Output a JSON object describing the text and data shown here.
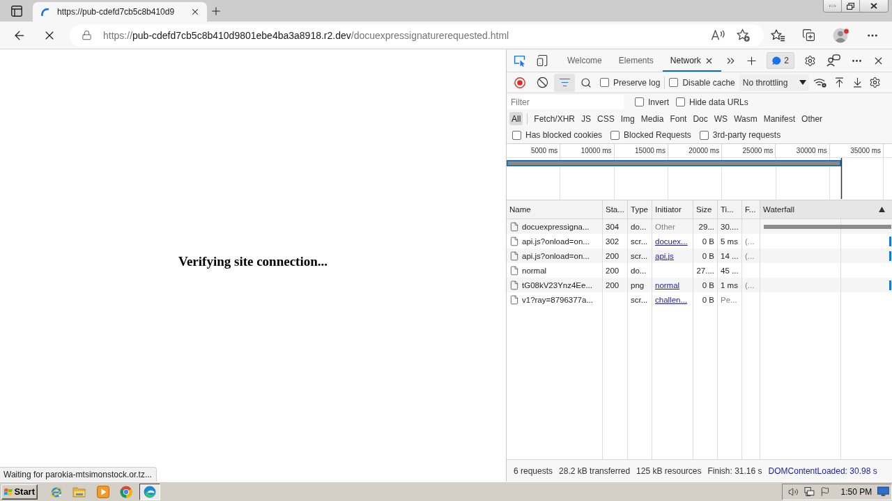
{
  "browser": {
    "tab": {
      "title": "https://pub-cdefd7cb5c8b410d9",
      "loading": true
    },
    "address": {
      "scheme": "https://",
      "host": "pub-cdefd7cb5c8b410d9801ebe4ba3a8918.r2.dev",
      "path": "/docuexpressignaturerequested.html"
    }
  },
  "page": {
    "message": "Verifying site connection...",
    "status": "Waiting for parokia-mtsimonstock.or.tz..."
  },
  "devtools": {
    "tabs": [
      {
        "label": "Welcome",
        "selected": false
      },
      {
        "label": "Elements",
        "selected": false
      },
      {
        "label": "Network",
        "selected": true
      }
    ],
    "issues_count": "2",
    "toolbar": {
      "recording": true,
      "filter_shown": true,
      "options": [
        {
          "label": "Preserve log",
          "checked": false
        },
        {
          "label": "Disable cache",
          "checked": false
        }
      ],
      "throttling": "No throttling"
    },
    "filter": {
      "placeholder": "Filter",
      "options": [
        {
          "label": "Invert",
          "checked": false
        },
        {
          "label": "Hide data URLs",
          "checked": false
        }
      ]
    },
    "type_filters": [
      {
        "label": "All",
        "selected": true
      },
      {
        "label": "Fetch/XHR",
        "selected": false
      },
      {
        "label": "JS",
        "selected": false
      },
      {
        "label": "CSS",
        "selected": false
      },
      {
        "label": "Img",
        "selected": false
      },
      {
        "label": "Media",
        "selected": false
      },
      {
        "label": "Font",
        "selected": false
      },
      {
        "label": "Doc",
        "selected": false
      },
      {
        "label": "WS",
        "selected": false
      },
      {
        "label": "Wasm",
        "selected": false
      },
      {
        "label": "Manifest",
        "selected": false
      },
      {
        "label": "Other",
        "selected": false
      }
    ],
    "request_filters": [
      {
        "label": "Has blocked cookies",
        "checked": false
      },
      {
        "label": "Blocked Requests",
        "checked": false
      },
      {
        "label": "3rd-party requests",
        "checked": false
      }
    ],
    "overview": {
      "ticks": [
        "5000 ms",
        "10000 ms",
        "15000 ms",
        "20000 ms",
        "25000 ms",
        "30000 ms",
        "35000 ms"
      ]
    },
    "table": {
      "columns": [
        {
          "label": "Name",
          "sorted": false
        },
        {
          "label": "Sta...",
          "sorted": false
        },
        {
          "label": "Type",
          "sorted": false
        },
        {
          "label": "Initiator",
          "sorted": false
        },
        {
          "label": "Size",
          "sorted": false
        },
        {
          "label": "Ti...",
          "sorted": false
        },
        {
          "label": "F...",
          "sorted": false
        },
        {
          "label": "Waterfall",
          "sorted": true
        }
      ],
      "rows": [
        {
          "name": "docuexpressigna...",
          "status": "304",
          "type": "do...",
          "initiator": {
            "text": "Other",
            "link": false
          },
          "size": "29...",
          "time": "30....",
          "pending": false,
          "waterfall": {
            "kind": "bar"
          }
        },
        {
          "name": "api.js?onload=on...",
          "status": "302",
          "type": "scr...",
          "initiator": {
            "text": "docuex...",
            "link": true
          },
          "size": "0 B",
          "time": "5 ms",
          "pending": false,
          "fulfilled": "(...",
          "waterfall": {
            "kind": "mark"
          }
        },
        {
          "name": "api.js?onload=on...",
          "status": "200",
          "type": "scr...",
          "initiator": {
            "text": "api.js",
            "link": true
          },
          "size": "0 B",
          "time": "14 ...",
          "pending": false,
          "fulfilled": "(...",
          "waterfall": {
            "kind": "mark"
          }
        },
        {
          "name": "normal",
          "status": "200",
          "type": "do...",
          "size": "27....",
          "time": "45 ...",
          "pending": false
        },
        {
          "name": "tG08kV23Ynz4Ee...",
          "status": "200",
          "type": "png",
          "initiator": {
            "text": "normal",
            "link": true
          },
          "size": "0 B",
          "time": "1 ms",
          "pending": false,
          "fulfilled": "(...",
          "waterfall": {
            "kind": "mark"
          }
        },
        {
          "name": "v1?ray=8796377a...",
          "type": "scr...",
          "initiator": {
            "text": "challen...",
            "link": true
          },
          "size": "0 B",
          "time": "Pe...",
          "pending": true
        }
      ]
    },
    "summary": {
      "items": [
        "6 requests",
        "28.2 kB transferred",
        "125 kB resources",
        "Finish: 31.16 s"
      ],
      "dom_content_loaded": "DOMContentLoaded: 30.98 s"
    }
  },
  "taskbar": {
    "start": "Start",
    "apps": [
      {
        "selected": false
      },
      {
        "selected": false
      },
      {
        "selected": false
      },
      {
        "selected": false
      },
      {
        "selected": true
      }
    ],
    "clock": "1:50 PM"
  }
}
